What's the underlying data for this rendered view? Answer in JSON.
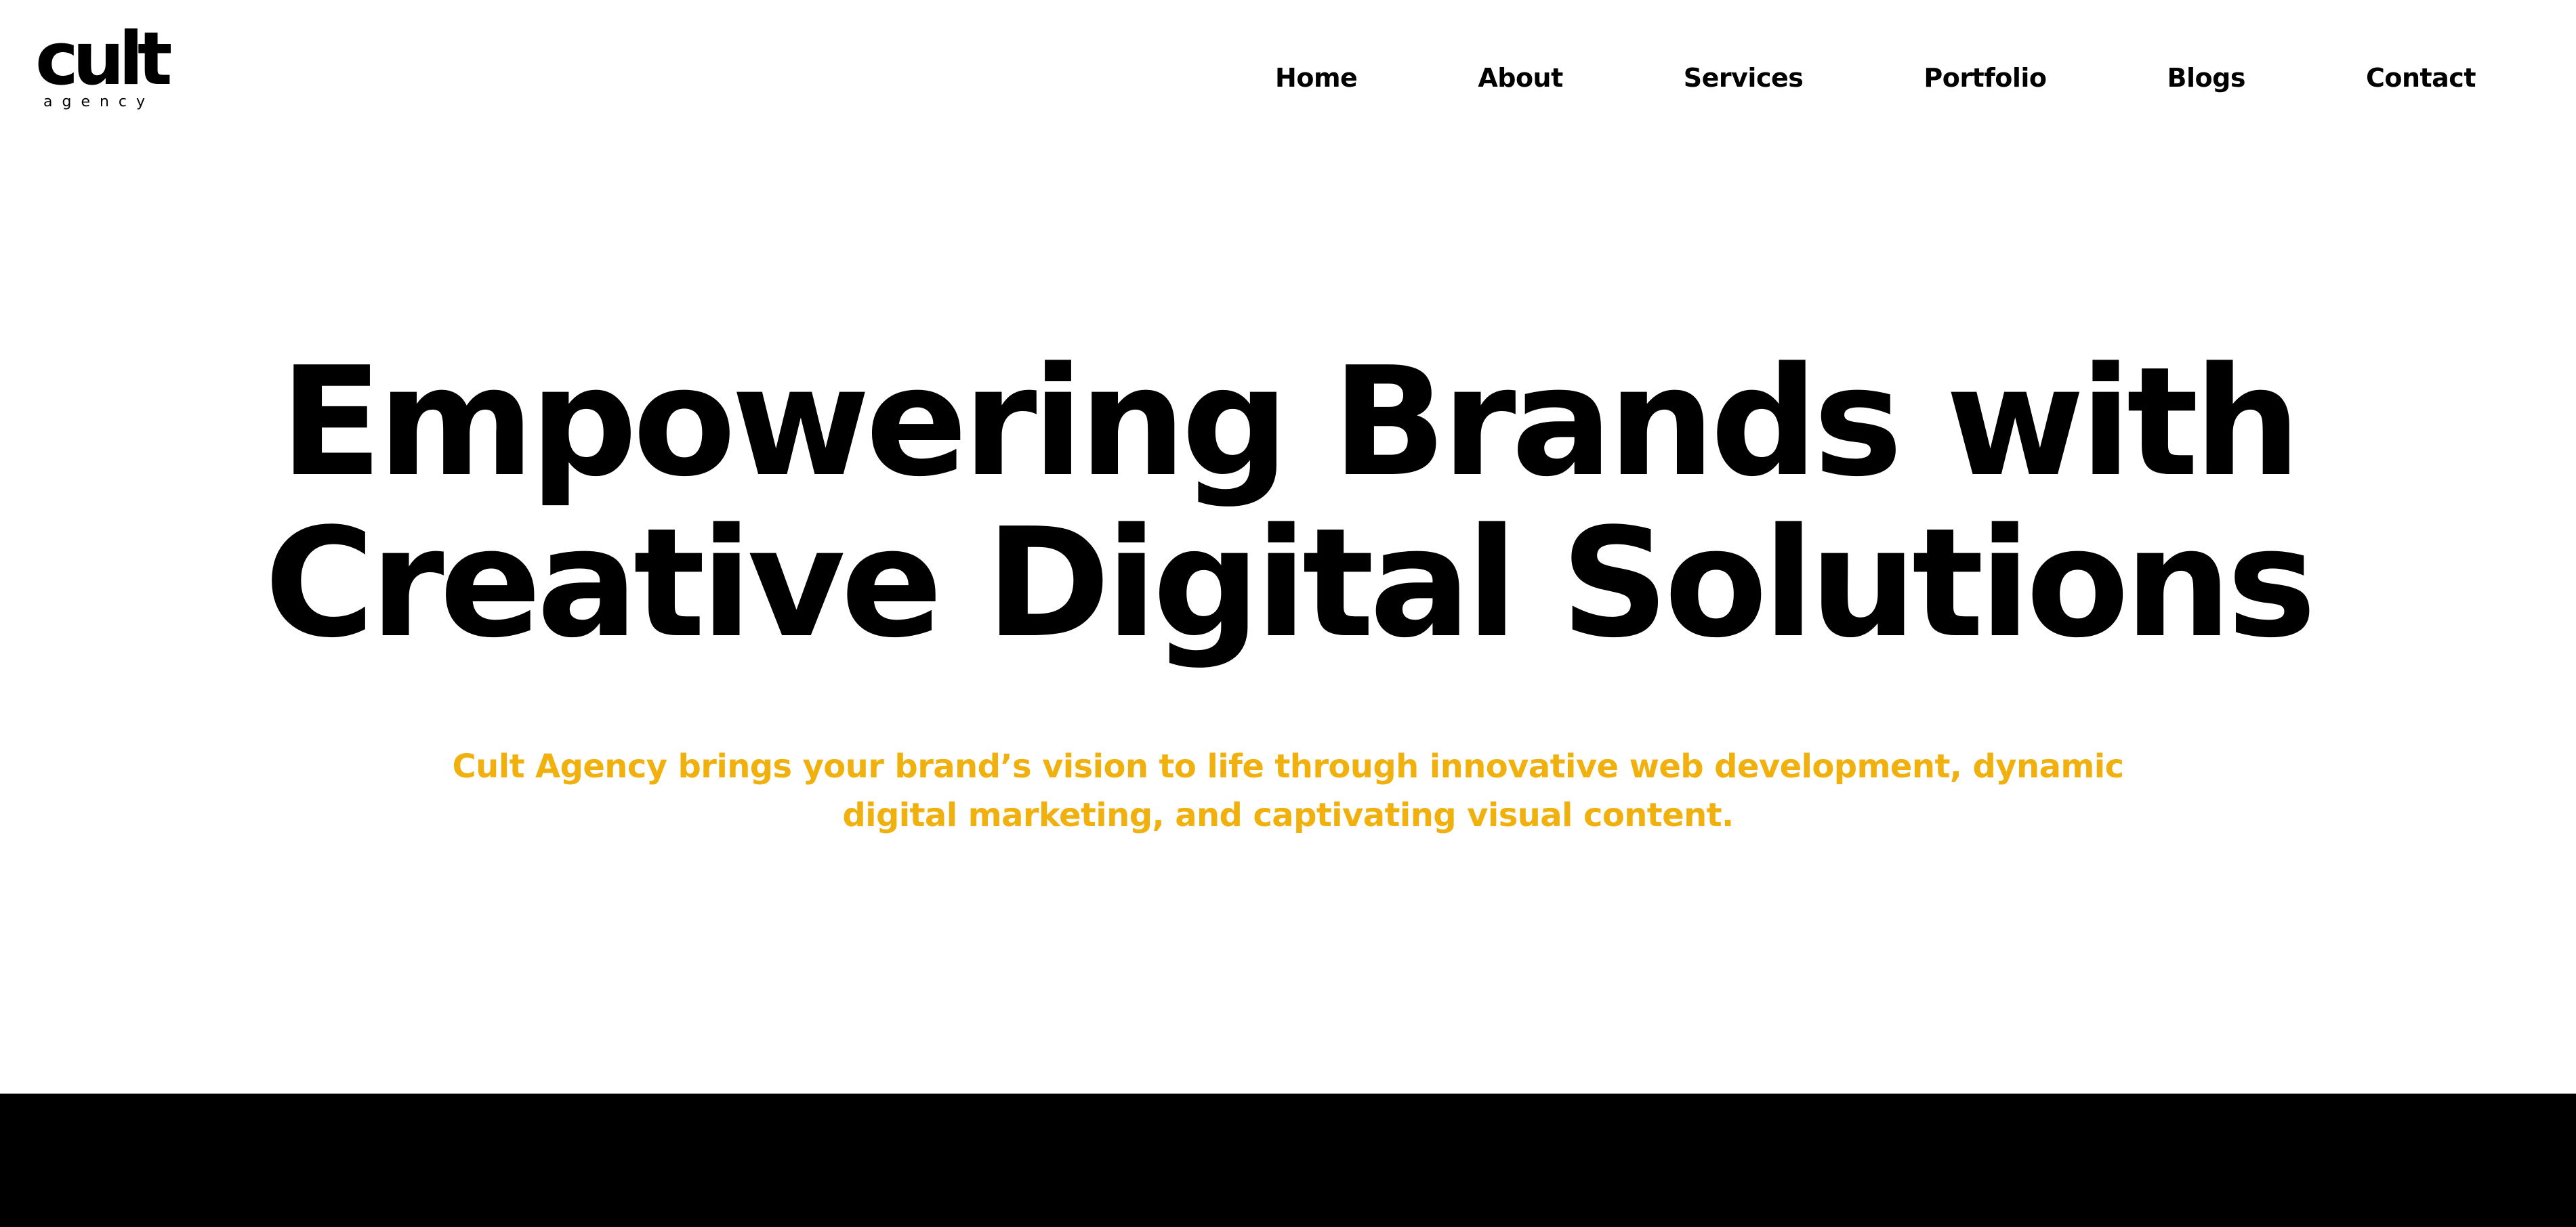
{
  "brand": {
    "logo_word": "cult",
    "logo_sub": "agency"
  },
  "nav": {
    "items": [
      {
        "label": "Home"
      },
      {
        "label": "About"
      },
      {
        "label": "Services"
      },
      {
        "label": "Portfolio"
      },
      {
        "label": "Blogs"
      },
      {
        "label": "Contact"
      }
    ]
  },
  "hero": {
    "headline_line1": "Empowering Brands with",
    "headline_line2": "Creative Digital Solutions",
    "tagline": "Cult Agency brings your brand’s vision to life through innovative web development, dynamic digital marketing, and captivating visual content."
  },
  "colors": {
    "background": "#FFFFFF",
    "text": "#000000",
    "accent": "#F0B10E",
    "band": "#000000"
  }
}
